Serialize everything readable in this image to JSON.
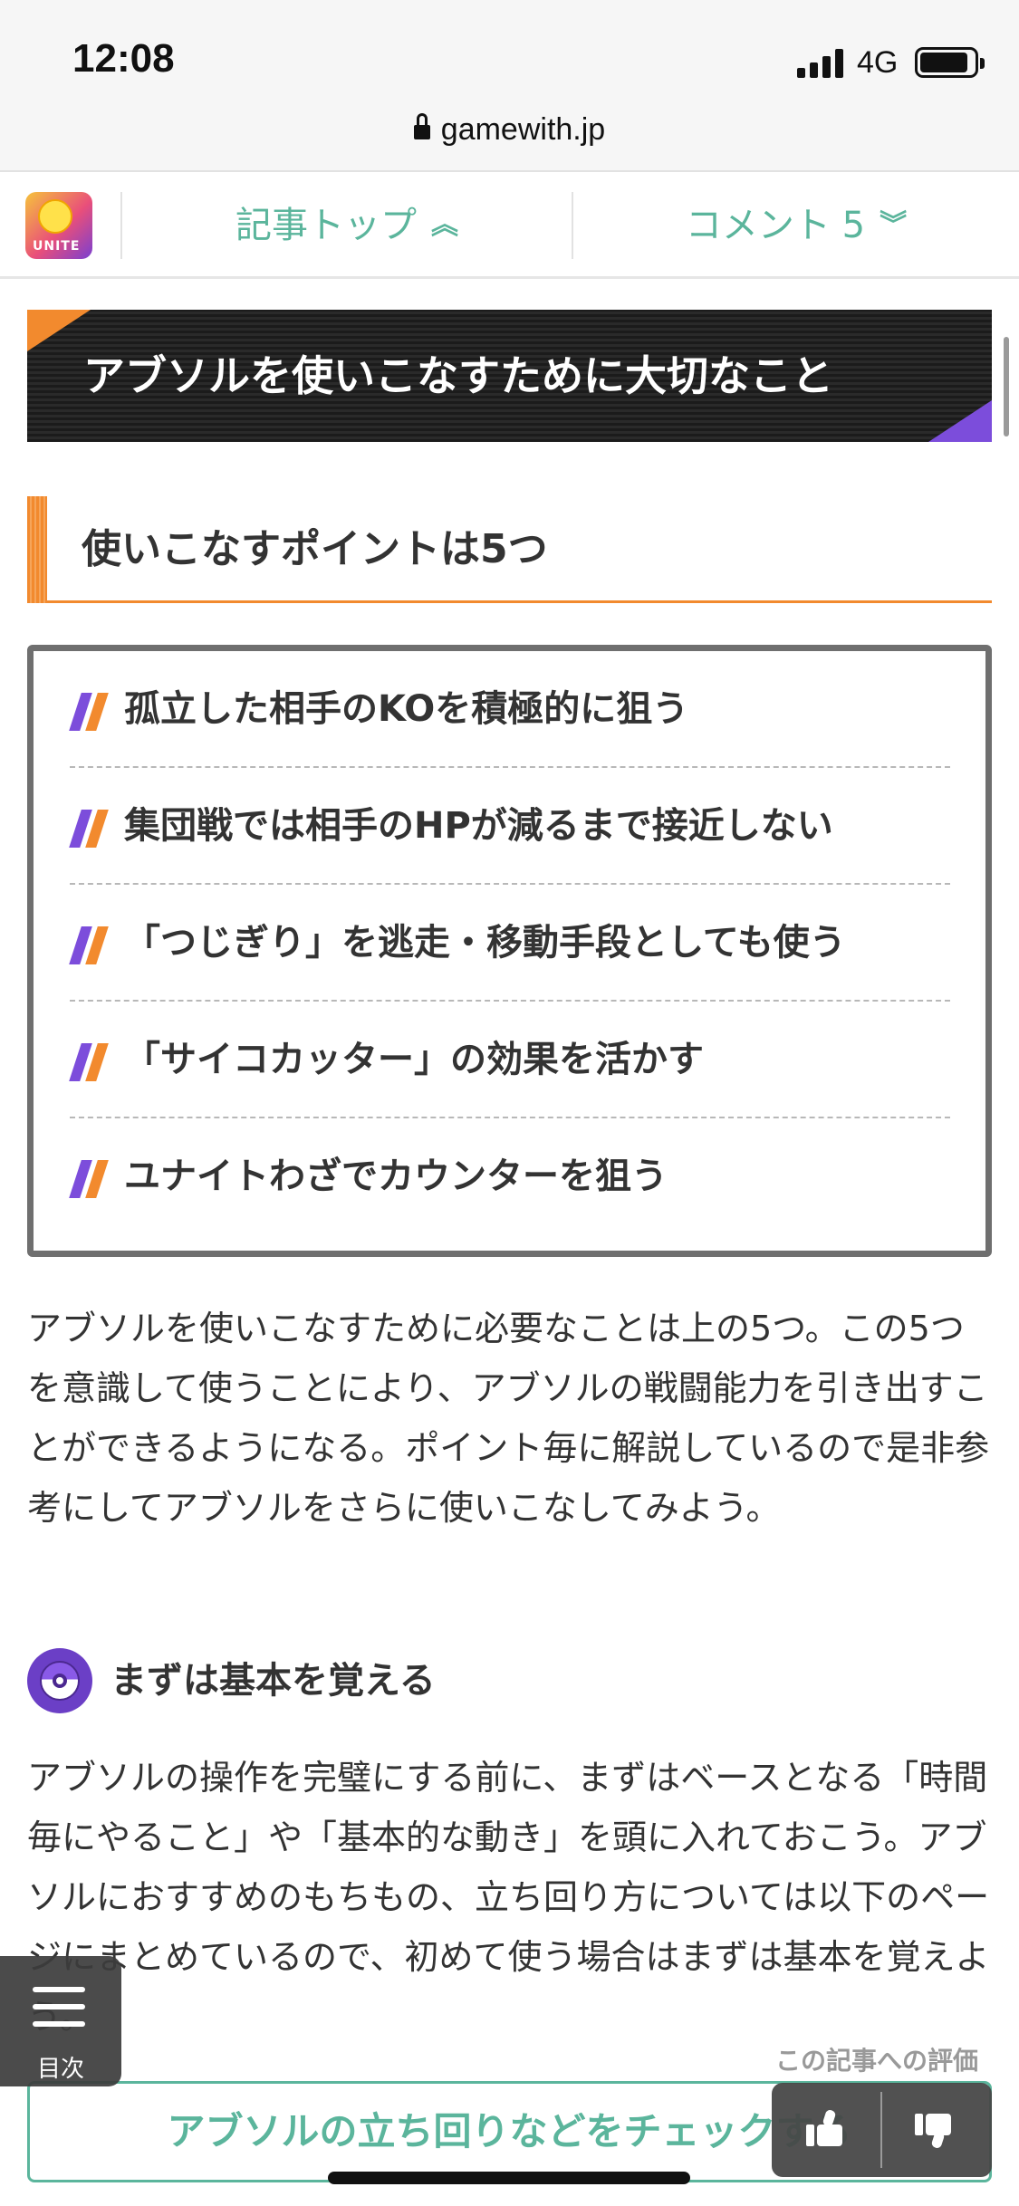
{
  "status_bar": {
    "time": "12:08",
    "network": "4G",
    "signal_bars": 4
  },
  "browser": {
    "url": "gamewith.jp"
  },
  "article_nav": {
    "app_icon": {
      "name": "pokemon-unite-icon",
      "text": "UNITE"
    },
    "top_label": "記事トップ",
    "top_icon": "chevron-double-up-icon",
    "comment_label": "コメント 5",
    "comment_icon": "chevron-double-down-icon"
  },
  "heading": {
    "title": "アブソルを使いこなすために大切なこと"
  },
  "subheading": {
    "title": "使いこなすポイントは5つ"
  },
  "points": [
    "孤立した相手のKOを積極的に狙う",
    "集団戦では相手のHPが減るまで接近しない",
    "「つじぎり」を逃走・移動手段としても使う",
    "「サイコカッター」の効果を活かす",
    "ユナイトわざでカウンターを狙う"
  ],
  "intro_paragraph": "アブソルを使いこなすために必要なことは上の5つ。この5つを意識して使うことにより、アブソルの戦闘能力を引き出すことができるようになる。ポイント毎に解説しているので是非参考にしてアブソルをさらに使いこなしてみよう。",
  "section": {
    "icon": "poke-ball-icon",
    "title": "まずは基本を覚える",
    "paragraph": "アブソルの操作を完璧にする前に、まずはベースとなる「時間毎にやること」や「基本的な動き」を頭に入れておこう。アブソルにおすすめのもちもの、立ち回り方については以下のページにまとめているので、初めて使う場合はまずは基本を覚えよう。"
  },
  "toc": {
    "label": "目次",
    "icon": "menu-icon"
  },
  "rating": {
    "label": "この記事への評価",
    "up_icon": "thumbs-up-icon",
    "down_icon": "thumbs-down-icon"
  },
  "cta": {
    "label": "アブソルの立ち回りなどをチェックする"
  },
  "colors": {
    "accent_green": "#5bb59c",
    "accent_orange": "#f28a2e",
    "accent_purple": "#7c4ddb",
    "banner_dark": "#1b1b1b"
  }
}
